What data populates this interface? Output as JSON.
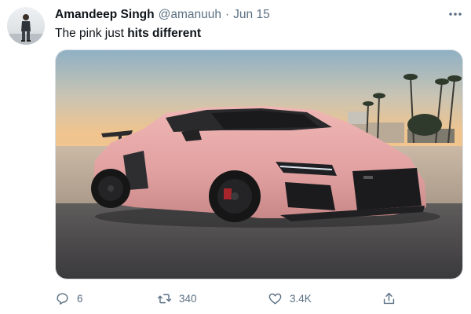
{
  "author": {
    "name": "Amandeep Singh",
    "handle": "@amanuuh",
    "separator": "·",
    "timestamp": "Jun 15"
  },
  "tweet": {
    "text_plain": "The pink just ",
    "text_bold": "hits different"
  },
  "actions": {
    "reply_count": "6",
    "retweet_count": "340",
    "like_count": "3.4K"
  },
  "icons": {
    "more": "more-horizontal-icon",
    "reply": "reply-icon",
    "retweet": "retweet-icon",
    "like": "heart-icon",
    "share": "share-icon"
  },
  "colors": {
    "text_primary": "#0f1419",
    "text_secondary": "#5b7083",
    "car_body": "#e4a3a3"
  }
}
